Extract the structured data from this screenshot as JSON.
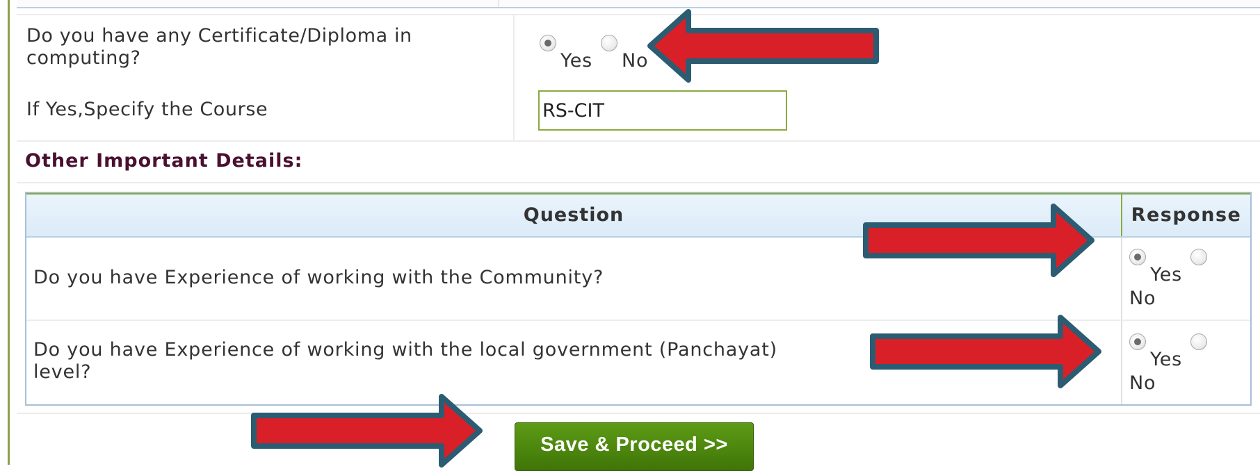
{
  "form": {
    "computing_question": "Do you have any Certificate/Diploma in computing?",
    "computing_question_line1": "Do you have any Certificate/Diploma in",
    "computing_question_line2": "computing?",
    "computing_answer": "Yes",
    "specify_label": "If Yes,Specify the Course",
    "course_value": "RS-CIT",
    "yes_label": "Yes",
    "no_label": "No"
  },
  "section": {
    "title": "Other Important Details:"
  },
  "table": {
    "columns": [
      "Question",
      "Response"
    ],
    "rows": [
      {
        "question": "Do you have Experience of working with the Community?",
        "answer": "Yes"
      },
      {
        "question": "Do you have Experience of working with the local government (Panchayat) level?",
        "line1": "Do you have Experience of working with the local government (Panchayat)",
        "line2": "level?",
        "answer": "Yes"
      }
    ]
  },
  "actions": {
    "save_label": "Save & Proceed >>"
  },
  "colors": {
    "arrow_fill": "#d92028",
    "arrow_outline": "#2c5c72",
    "button": "#4a8410",
    "input_border": "#8aab3c",
    "header_bg": "#e3eff9"
  }
}
